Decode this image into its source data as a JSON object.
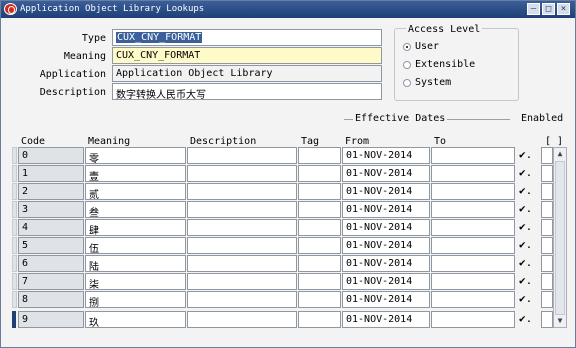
{
  "window": {
    "title": "Application Object Library Lookups"
  },
  "header": {
    "type_label": "Type",
    "type_value": "CUX_CNY_FORMAT",
    "meaning_label": "Meaning",
    "meaning_value": "CUX_CNY_FORMAT",
    "application_label": "Application",
    "application_value": "Application Object Library",
    "description_label": "Description",
    "description_value": "数字转换人民币大写"
  },
  "access_level": {
    "title": "Access Level",
    "options": [
      {
        "label": "User",
        "selected": true
      },
      {
        "label": "Extensible",
        "selected": false
      },
      {
        "label": "System",
        "selected": false
      }
    ]
  },
  "table": {
    "group_label": "Effective Dates",
    "enabled_label": "Enabled",
    "dff_label": "[ ]",
    "columns": {
      "code": "Code",
      "meaning": "Meaning",
      "description": "Description",
      "tag": "Tag",
      "from": "From",
      "to": "To"
    },
    "rows": [
      {
        "code": "0",
        "meaning": "零",
        "description": "",
        "tag": "",
        "from": "01-NOV-2014",
        "to": "",
        "enabled": true
      },
      {
        "code": "1",
        "meaning": "壹",
        "description": "",
        "tag": "",
        "from": "01-NOV-2014",
        "to": "",
        "enabled": true
      },
      {
        "code": "2",
        "meaning": "贰",
        "description": "",
        "tag": "",
        "from": "01-NOV-2014",
        "to": "",
        "enabled": true
      },
      {
        "code": "3",
        "meaning": "叁",
        "description": "",
        "tag": "",
        "from": "01-NOV-2014",
        "to": "",
        "enabled": true
      },
      {
        "code": "4",
        "meaning": "肆",
        "description": "",
        "tag": "",
        "from": "01-NOV-2014",
        "to": "",
        "enabled": true
      },
      {
        "code": "5",
        "meaning": "伍",
        "description": "",
        "tag": "",
        "from": "01-NOV-2014",
        "to": "",
        "enabled": true
      },
      {
        "code": "6",
        "meaning": "陆",
        "description": "",
        "tag": "",
        "from": "01-NOV-2014",
        "to": "",
        "enabled": true
      },
      {
        "code": "7",
        "meaning": "柒",
        "description": "",
        "tag": "",
        "from": "01-NOV-2014",
        "to": "",
        "enabled": true
      },
      {
        "code": "8",
        "meaning": "捌",
        "description": "",
        "tag": "",
        "from": "01-NOV-2014",
        "to": "",
        "enabled": true
      },
      {
        "code": "9",
        "meaning": "玖",
        "description": "",
        "tag": "",
        "from": "01-NOV-2014",
        "to": "",
        "enabled": true
      }
    ]
  },
  "colors": {
    "titlebar": "#1e3f77",
    "required_field": "#fffbc8",
    "selection": "#3b5f9a"
  }
}
